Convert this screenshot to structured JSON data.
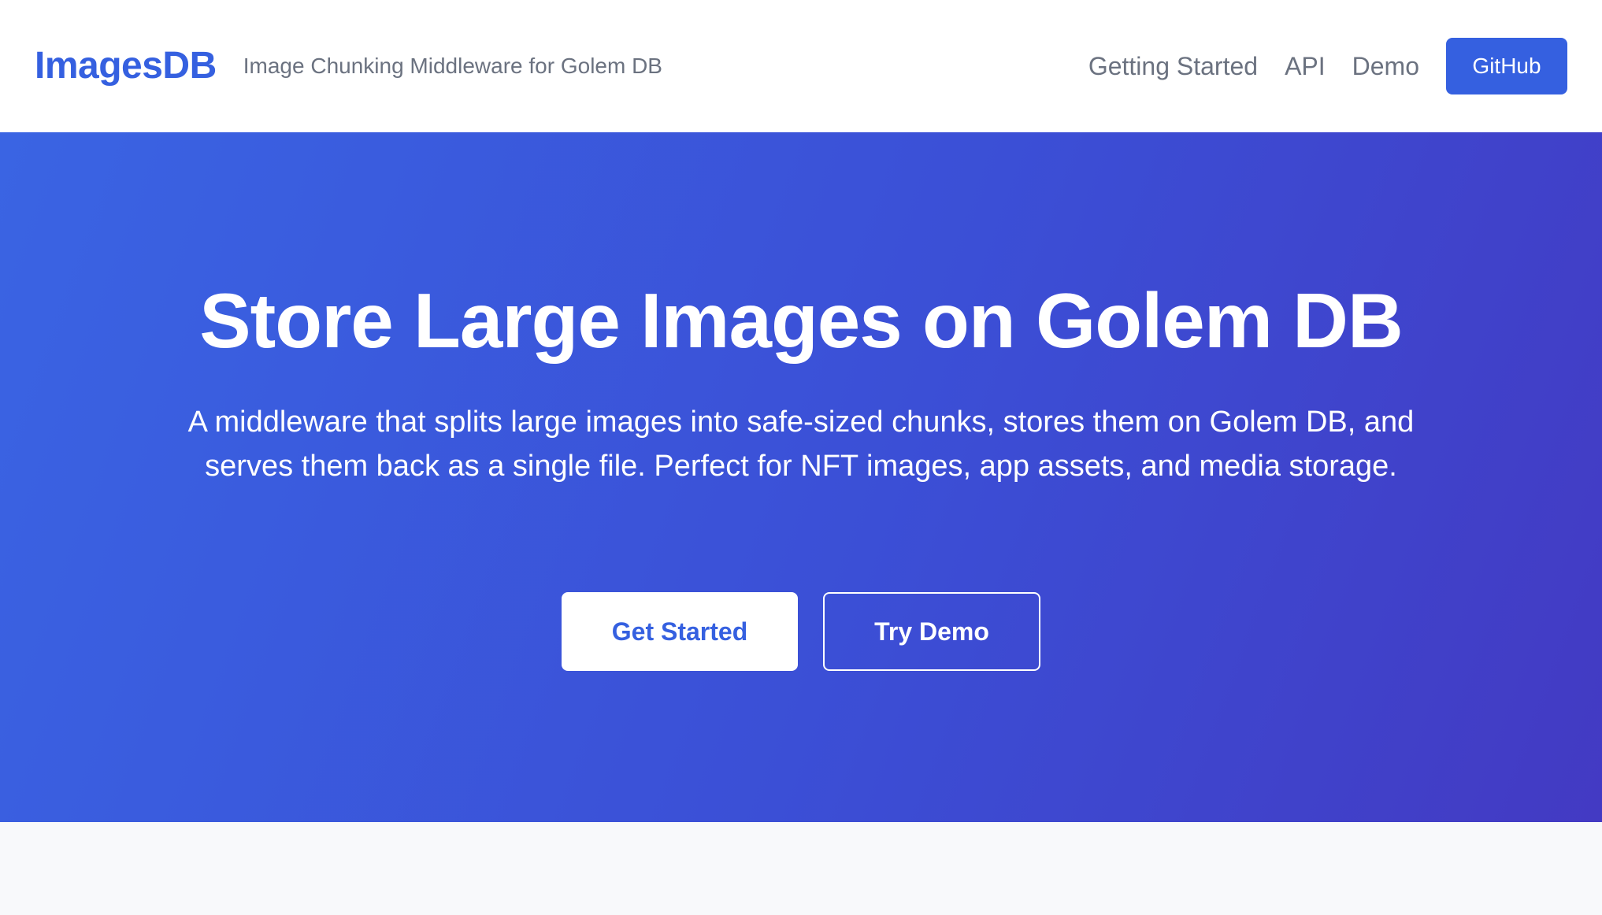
{
  "header": {
    "logo": "ImagesDB",
    "tagline": "Image Chunking Middleware for Golem DB",
    "nav": [
      {
        "label": "Getting Started"
      },
      {
        "label": "API"
      },
      {
        "label": "Demo"
      }
    ],
    "github_label": "GitHub"
  },
  "hero": {
    "title": "Store Large Images on Golem DB",
    "description": "A middleware that splits large images into safe-sized chunks, stores them on Golem DB, and serves them back as a single file. Perfect for NFT images, app assets, and media storage.",
    "primary_button": "Get Started",
    "secondary_button": "Try Demo"
  },
  "colors": {
    "brand": "#3560e0",
    "hero_gradient_start": "#3a64e3",
    "hero_gradient_end": "#433ac3",
    "muted_text": "#6b7280"
  }
}
